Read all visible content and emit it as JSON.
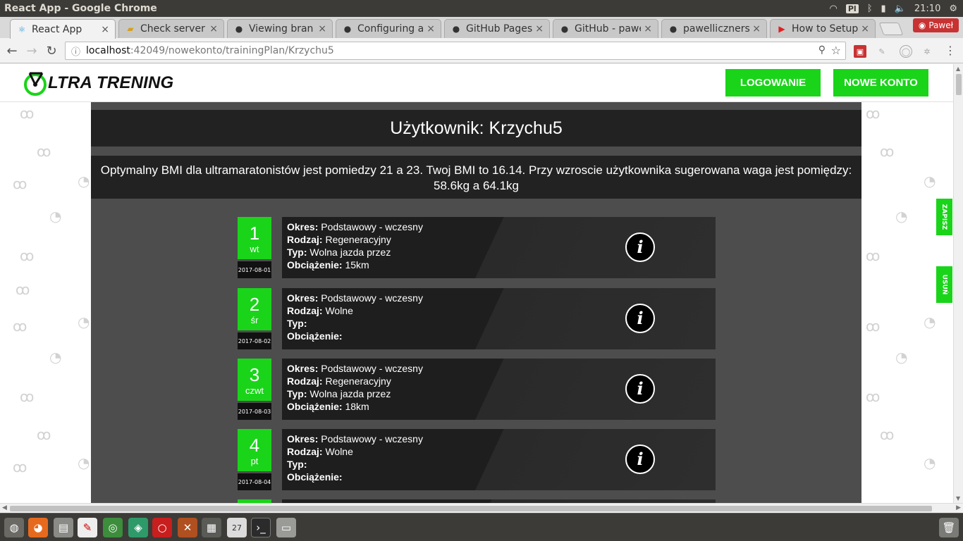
{
  "os": {
    "window_title": "React App - Google Chrome",
    "keyboard_layout": "Pl",
    "clock": "21:10"
  },
  "browser": {
    "tabs": [
      {
        "label": "React App",
        "icon": "react-icon",
        "active": true
      },
      {
        "label": "Check server",
        "icon": "server-icon",
        "active": false
      },
      {
        "label": "Viewing bran",
        "icon": "github-icon",
        "active": false
      },
      {
        "label": "Configuring a",
        "icon": "github-icon",
        "active": false
      },
      {
        "label": "GitHub Pages",
        "icon": "github-icon",
        "active": false
      },
      {
        "label": "GitHub - pawe",
        "icon": "github-icon",
        "active": false
      },
      {
        "label": "pawelliczners",
        "icon": "github-icon",
        "active": false
      },
      {
        "label": "How to Setup",
        "icon": "youtube-icon",
        "active": false
      }
    ],
    "profile_name": "Paweł",
    "url_host": "localhost",
    "url_path": ":42049/nowekonto/trainingPlan/Krzychu5"
  },
  "app": {
    "logo_text": "LTRA TRENING",
    "nav": {
      "login_label": "LOGOWANIE",
      "signup_label": "NOWE KONTO"
    },
    "user_title": "Użytkownik: Krzychu5",
    "bmi_text": "Optymalny BMI dla ultramaratonistów jest pomiedzy 21 a 23. Twoj BMI to 16.14. Przy wzroscie użytkownika sugerowana waga jest pomiędzy: 58.6kg a 64.1kg",
    "side_buttons": {
      "save_label": "ZAPISZ",
      "delete_label": "USUŃ"
    },
    "field_labels": {
      "period": "Okres:",
      "kind": "Rodzaj:",
      "type": "Typ:",
      "load": "Obciążenie:"
    },
    "days": [
      {
        "num": "1",
        "dow": "wt",
        "date": "2017-08-01",
        "period": "Podstawowy - wczesny",
        "kind": "Regeneracyjny",
        "type": "Wolna jazda przez",
        "load": "15km"
      },
      {
        "num": "2",
        "dow": "śr",
        "date": "2017-08-02",
        "period": "Podstawowy - wczesny",
        "kind": "Wolne",
        "type": "",
        "load": ""
      },
      {
        "num": "3",
        "dow": "czwt",
        "date": "2017-08-03",
        "period": "Podstawowy - wczesny",
        "kind": "Regeneracyjny",
        "type": "Wolna jazda przez",
        "load": "18km"
      },
      {
        "num": "4",
        "dow": "pt",
        "date": "2017-08-04",
        "period": "Podstawowy - wczesny",
        "kind": "Wolne",
        "type": "",
        "load": ""
      }
    ],
    "accent_color": "#1ad41a"
  }
}
